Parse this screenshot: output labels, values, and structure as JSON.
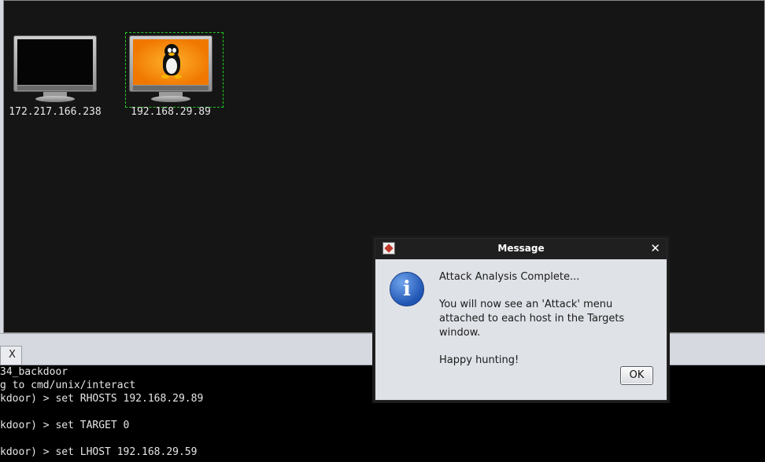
{
  "targets": {
    "hosts": [
      {
        "ip": "172.217.166.238",
        "os": "unknown"
      },
      {
        "ip": "192.168.29.89",
        "os": "linux",
        "selected": true
      }
    ]
  },
  "tab": {
    "close_label": "X"
  },
  "console": {
    "lines": [
      "34_backdoor",
      "g to cmd/unix/interact",
      "kdoor) > set RHOSTS 192.168.29.89",
      "",
      "kdoor) > set TARGET 0",
      "",
      "kdoor) > set LHOST 192.168.29.59"
    ]
  },
  "dialog": {
    "title": "Message",
    "close_label": "✕",
    "icon": "info-icon",
    "line1": "Attack Analysis Complete...",
    "line2": "You will now see an 'Attack' menu attached to each host in the Targets window.",
    "line3": "Happy hunting!",
    "ok_label": "OK"
  },
  "colors": {
    "background": "#151515",
    "selection": "#22cc22",
    "dialog": "#dfe2e7"
  }
}
